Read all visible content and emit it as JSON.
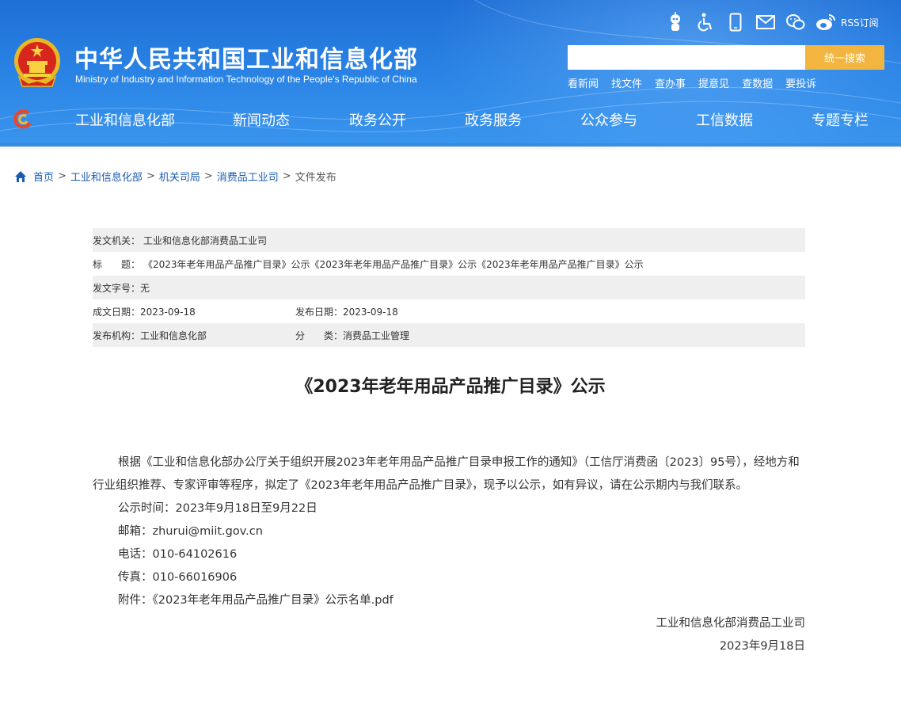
{
  "header": {
    "site_title": "中华人民共和国工业和信息化部",
    "site_subtitle": "Ministry of Industry and Information Technology of the People's Republic of China",
    "rss_label": "RSS订阅",
    "search": {
      "placeholder": "",
      "button_label": "统一搜索"
    },
    "quick_links": [
      "看新闻",
      "找文件",
      "查办事",
      "提意见",
      "查数据",
      "要投诉"
    ],
    "nav": [
      "工业和信息化部",
      "新闻动态",
      "政务公开",
      "政务服务",
      "公众参与",
      "工信数据",
      "专题专栏"
    ],
    "colors": {
      "header_blue": "#2b85e6",
      "search_button": "#f2b640"
    }
  },
  "breadcrumb": [
    "首页",
    "工业和信息化部",
    "机关司局",
    "消费品工业司",
    "文件发布"
  ],
  "meta": {
    "issuer_label": "发文机关：",
    "issuer_value": "工业和信息化部消费品工业司",
    "title_label": "标　　题：",
    "title_value": "《2023年老年用品产品推广目录》公示《2023年老年用品产品推广目录》公示《2023年老年用品产品推广目录》公示",
    "docno_label": "发文字号：",
    "docno_value": "无",
    "date_made_label": "成文日期：",
    "date_made_value": "2023-09-18",
    "date_pub_label": "发布日期：",
    "date_pub_value": "2023-09-18",
    "org_label": "发布机构：",
    "org_value": "工业和信息化部",
    "category_label": "分　　类：",
    "category_value": "消费品工业管理"
  },
  "article": {
    "title": "《2023年老年用品产品推广目录》公示",
    "paragraph": "根据《工业和信息化部办公厅关于组织开展2023年老年用品产品推广目录申报工作的通知》（工信厅消费函〔2023〕95号），经地方和行业组织推荐、专家评审等程序，拟定了《2023年老年用品产品推广目录》，现予以公示，如有异议，请在公示期内与我们联系。",
    "period": "公示时间：2023年9月18日至9月22日",
    "email": "邮箱：zhurui@miit.gov.cn",
    "phone": "电话：010-64102616",
    "fax": "传真：010-66016906",
    "attachment": "附件：《2023年老年用品产品推广目录》公示名单.pdf",
    "signature": "工业和信息化部消费品工业司",
    "date": "2023年9月18日"
  }
}
